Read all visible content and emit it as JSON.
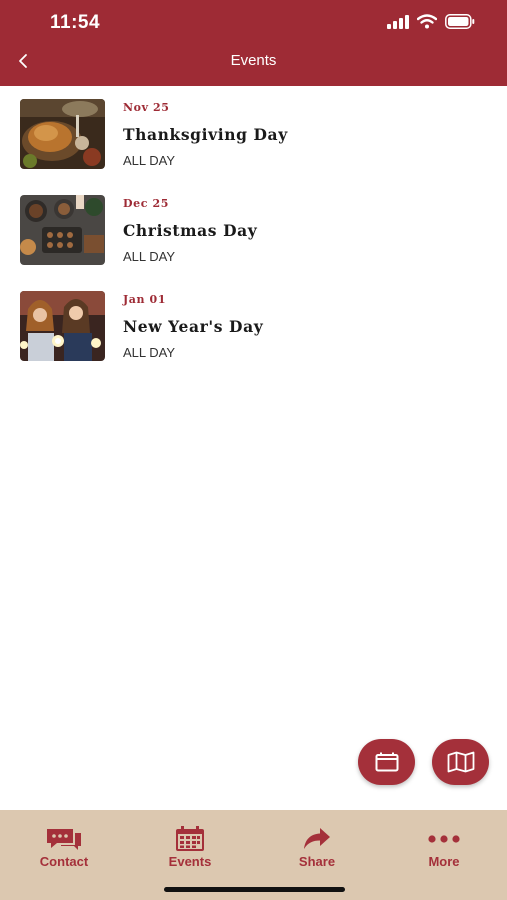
{
  "status_bar": {
    "time": "11:54"
  },
  "nav": {
    "title": "Events"
  },
  "events": [
    {
      "date": "Nov 25",
      "title": "Thanksgiving Day",
      "time": "ALL DAY",
      "image": "thanksgiving-dinner-photo"
    },
    {
      "date": "Dec 25",
      "title": "Christmas Day",
      "time": "ALL DAY",
      "image": "christmas-food-photo"
    },
    {
      "date": "Jan 01",
      "title": "New Year's Day",
      "time": "ALL DAY",
      "image": "new-year-sparklers-photo"
    }
  ],
  "fabs": {
    "calendar_icon": "calendar-icon",
    "map_icon": "map-icon"
  },
  "tabs": [
    {
      "label": "Contact",
      "icon": "chat-icon"
    },
    {
      "label": "Events",
      "icon": "calendar-icon"
    },
    {
      "label": "Share",
      "icon": "share-icon"
    },
    {
      "label": "More",
      "icon": "more-icon"
    }
  ],
  "colors": {
    "accent": "#9e2b35",
    "tabbar": "#dcc8b0"
  }
}
